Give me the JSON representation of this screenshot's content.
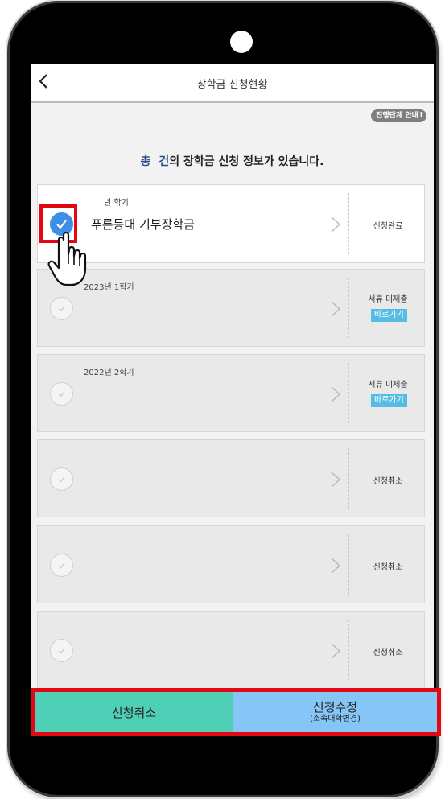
{
  "header": {
    "title": "장학금 신청현황",
    "back_icon": "chevron-left-icon"
  },
  "guide": {
    "label": "진행단계 안내",
    "icon": "i"
  },
  "summary": {
    "prefix": "총",
    "count": "건",
    "text": "의 장학금 신청 정보가 있습니다."
  },
  "cards": [
    {
      "period": "년  학기",
      "name": "푸른등대 기부장학금",
      "status": "신청완료",
      "checked": true
    },
    {
      "period": "2023년 1학기",
      "name": "",
      "status": "서류 미제출",
      "action": "바로가기",
      "checked": false
    },
    {
      "period": "2022년 2학기",
      "name": "",
      "status": "서류 미제출",
      "action": "바로가기",
      "checked": false
    },
    {
      "period": "",
      "name": "",
      "status": "신청취소",
      "checked": false
    },
    {
      "period": "",
      "name": "",
      "status": "신청취소",
      "checked": false
    },
    {
      "period": "",
      "name": "",
      "status": "신청취소",
      "checked": false
    }
  ],
  "footer": {
    "cancel_label": "신청취소",
    "edit_label": "신청수정",
    "edit_sub": "(소속대학변경)"
  },
  "colors": {
    "highlight": "#e30613",
    "check_active": "#3d8ee6",
    "cancel_button": "#4ecfb6",
    "edit_button": "#86c6f7",
    "goto_badge": "#55bde4"
  }
}
